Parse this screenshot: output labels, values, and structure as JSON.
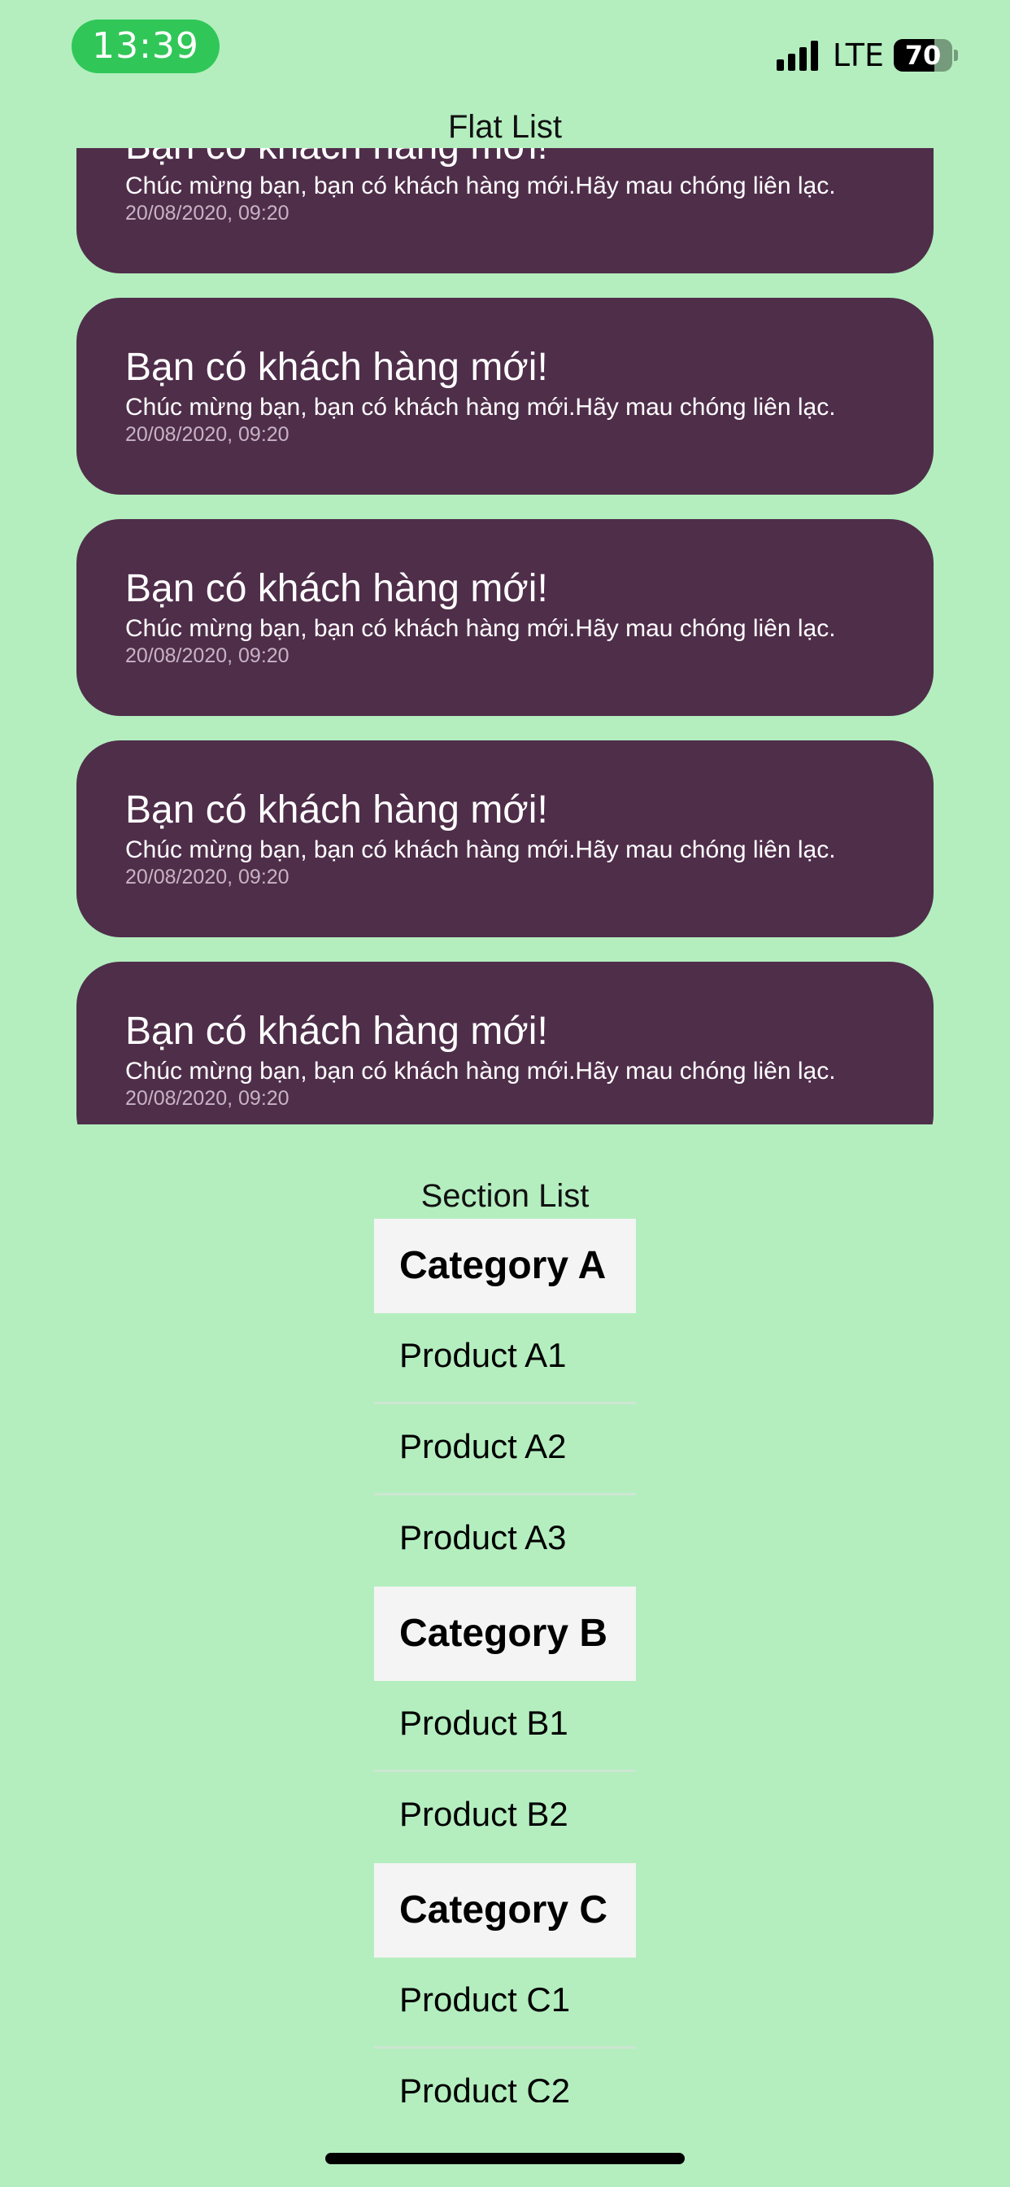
{
  "status_bar": {
    "time": "13:39",
    "network": "LTE",
    "battery": "70",
    "battery_level": 0.7
  },
  "flat_list": {
    "title": "Flat List",
    "items": [
      {
        "title": "Bạn có khách hàng mới!",
        "message": "Chúc mừng bạn, bạn có khách hàng mới.Hãy mau chóng liên lạc.",
        "time": "20/08/2020, 09:20"
      },
      {
        "title": "Bạn có khách hàng mới!",
        "message": "Chúc mừng bạn, bạn có khách hàng mới.Hãy mau chóng liên lạc.",
        "time": "20/08/2020, 09:20"
      },
      {
        "title": "Bạn có khách hàng mới!",
        "message": "Chúc mừng bạn, bạn có khách hàng mới.Hãy mau chóng liên lạc.",
        "time": "20/08/2020, 09:20"
      },
      {
        "title": "Bạn có khách hàng mới!",
        "message": "Chúc mừng bạn, bạn có khách hàng mới.Hãy mau chóng liên lạc.",
        "time": "20/08/2020, 09:20"
      },
      {
        "title": "Bạn có khách hàng mới!",
        "message": "Chúc mừng bạn, bạn có khách hàng mới.Hãy mau chóng liên lạc.",
        "time": "20/08/2020, 09:20"
      }
    ]
  },
  "section_list": {
    "title": "Section List",
    "sections": [
      {
        "header": "Category A",
        "items": [
          "Product A1",
          "Product A2",
          "Product A3"
        ]
      },
      {
        "header": "Category B",
        "items": [
          "Product B1",
          "Product B2"
        ]
      },
      {
        "header": "Category C",
        "items": [
          "Product C1",
          "Product C2"
        ]
      }
    ]
  },
  "colors": {
    "background": "#b4eebf",
    "card": "#4f2e4a",
    "section_header": "#f4f4f4",
    "time_pill": "#30c758"
  }
}
